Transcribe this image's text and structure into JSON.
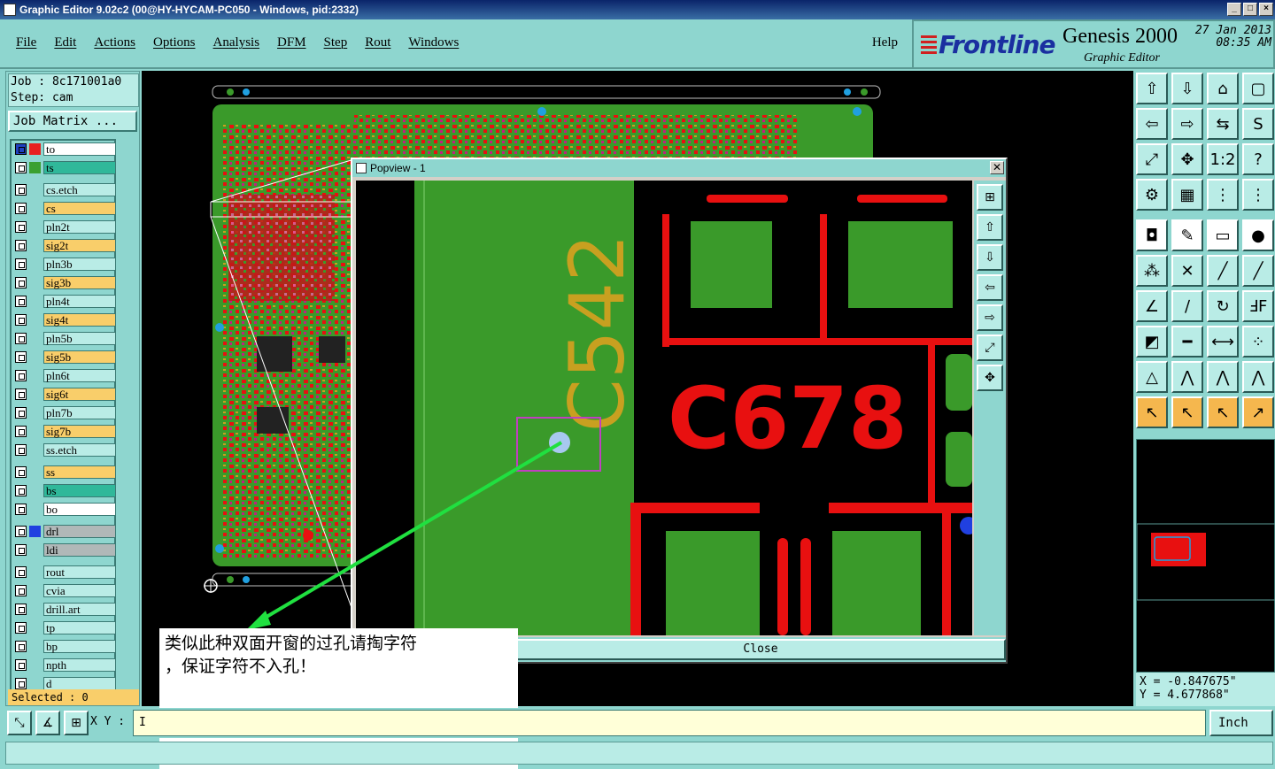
{
  "window": {
    "title": "Graphic Editor 9.02c2 (00@HY-HYCAM-PC050 - Windows, pid:2332)",
    "controls": [
      "_",
      "□",
      "×"
    ]
  },
  "menu": {
    "items": [
      "File",
      "Edit",
      "Actions",
      "Options",
      "Analysis",
      "DFM",
      "Step",
      "Rout",
      "Windows"
    ],
    "help": "Help"
  },
  "brand": {
    "logo": "Frontline",
    "product": "Genesis 2000",
    "subtitle": "Graphic Editor",
    "date": "27 Jan 2013",
    "time": "08:35 AM"
  },
  "job": {
    "job_line": "Job : 8c171001a0",
    "step_line": "Step: cam",
    "matrix_button": "Job Matrix ..."
  },
  "layers": [
    {
      "name": "to",
      "bg": "#ffffff",
      "swatch": "#e82020",
      "color": "#e82020"
    },
    {
      "name": "ts",
      "bg": "#30b89a",
      "swatch": "#3aa030",
      "color": ""
    },
    {
      "name": "cs.etch",
      "bg": "#b9ece6",
      "swatch": "",
      "color": ""
    },
    {
      "name": "cs",
      "bg": "#f9ce6a",
      "swatch": "",
      "color": ""
    },
    {
      "name": "pln2t",
      "bg": "#b9ece6",
      "swatch": "",
      "color": ""
    },
    {
      "name": "sig2t",
      "bg": "#f9ce6a",
      "swatch": "",
      "color": ""
    },
    {
      "name": "pln3b",
      "bg": "#b9ece6",
      "swatch": "",
      "color": ""
    },
    {
      "name": "sig3b",
      "bg": "#f9ce6a",
      "swatch": "",
      "color": ""
    },
    {
      "name": "pln4t",
      "bg": "#b9ece6",
      "swatch": "",
      "color": ""
    },
    {
      "name": "sig4t",
      "bg": "#f9ce6a",
      "swatch": "",
      "color": ""
    },
    {
      "name": "pln5b",
      "bg": "#b9ece6",
      "swatch": "",
      "color": ""
    },
    {
      "name": "sig5b",
      "bg": "#f9ce6a",
      "swatch": "",
      "color": ""
    },
    {
      "name": "pln6t",
      "bg": "#b9ece6",
      "swatch": "",
      "color": ""
    },
    {
      "name": "sig6t",
      "bg": "#f9ce6a",
      "swatch": "",
      "color": ""
    },
    {
      "name": "pln7b",
      "bg": "#b9ece6",
      "swatch": "",
      "color": ""
    },
    {
      "name": "sig7b",
      "bg": "#f9ce6a",
      "swatch": "",
      "color": ""
    },
    {
      "name": "ss.etch",
      "bg": "#b9ece6",
      "swatch": "",
      "color": ""
    },
    {
      "name": "ss",
      "bg": "#f9ce6a",
      "swatch": "",
      "color": ""
    },
    {
      "name": "bs",
      "bg": "#30b89a",
      "swatch": "",
      "color": ""
    },
    {
      "name": "bo",
      "bg": "#ffffff",
      "swatch": "",
      "color": ""
    },
    {
      "name": "drl",
      "bg": "#b0b8b8",
      "swatch": "#2040e0",
      "color": ""
    },
    {
      "name": "ldi",
      "bg": "#b0b8b8",
      "swatch": "",
      "color": ""
    },
    {
      "name": "rout",
      "bg": "#b9ece6",
      "swatch": "",
      "color": ""
    },
    {
      "name": "cvia",
      "bg": "#b9ece6",
      "swatch": "",
      "color": ""
    },
    {
      "name": "drill.art",
      "bg": "#b9ece6",
      "swatch": "",
      "color": ""
    },
    {
      "name": "tp",
      "bg": "#b9ece6",
      "swatch": "",
      "color": ""
    },
    {
      "name": "bp",
      "bg": "#b9ece6",
      "swatch": "",
      "color": ""
    },
    {
      "name": "npth",
      "bg": "#b9ece6",
      "swatch": "",
      "color": ""
    },
    {
      "name": "d",
      "bg": "#b9ece6",
      "swatch": "",
      "color": ""
    }
  ],
  "selected": "Selected : 0",
  "popview": {
    "title": "Popview - 1",
    "close_label": "Close",
    "ref_big": "C678",
    "ref_small": "C542"
  },
  "note": {
    "line1": "类似此种双面开窗的过孔请掏字符",
    "line2": "，保证字符不入孔！"
  },
  "coords": {
    "x": "X = -0.847675\"",
    "y": "Y = 4.677868\""
  },
  "bottom": {
    "xy_label": "X Y :",
    "xy_value": "I",
    "unit": "Inch"
  },
  "colors": {
    "teal_bg": "#8ed6cf",
    "pcb_green": "#3a9a2a",
    "pcb_red": "#e81010",
    "silk_yellow": "#c8a020",
    "arrow_green": "#20e040",
    "highlight_magenta": "#c040c0"
  }
}
